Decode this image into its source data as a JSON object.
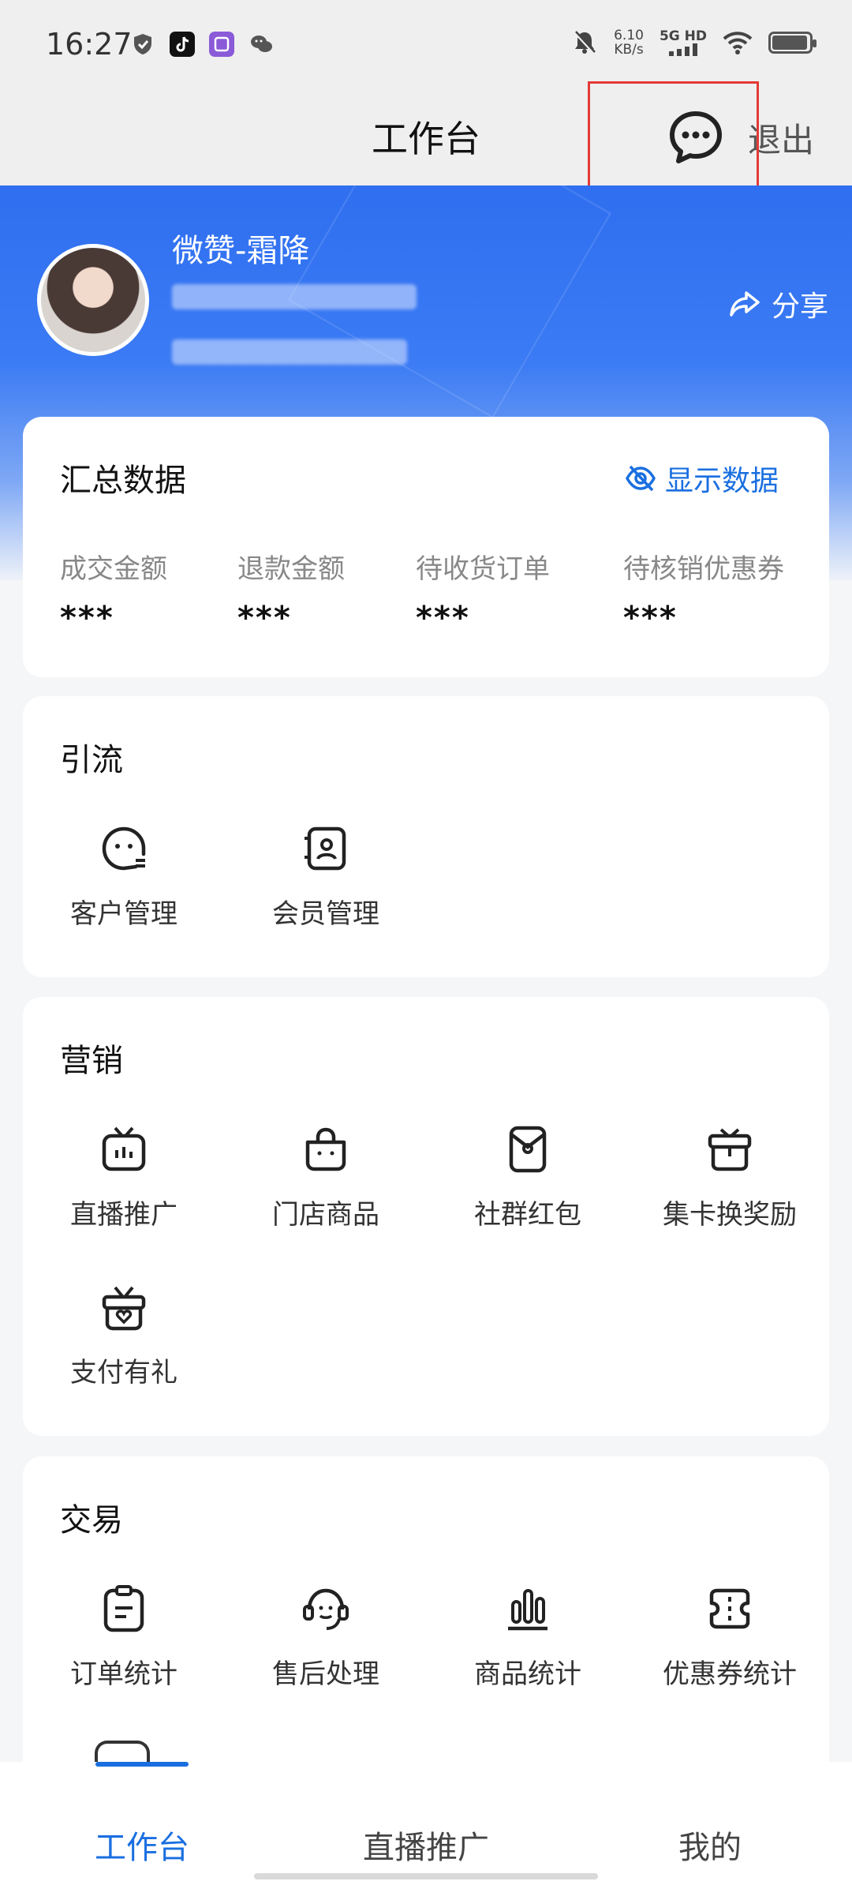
{
  "status_bar": {
    "time": "16:27",
    "net_speed_value": "6.10",
    "net_speed_unit": "KB/s",
    "signal_label": "5G HD"
  },
  "header": {
    "title": "工作台",
    "logout_label": "退出"
  },
  "profile": {
    "name": "微赞-霜降",
    "share_label": "分享"
  },
  "summary": {
    "title": "汇总数据",
    "show_data_label": "显示数据",
    "stats": [
      {
        "label": "成交金额",
        "value": "***"
      },
      {
        "label": "退款金额",
        "value": "***"
      },
      {
        "label": "待收货订单",
        "value": "***"
      },
      {
        "label": "待核销优惠券",
        "value": "***"
      }
    ]
  },
  "traffic": {
    "title": "引流",
    "items": [
      {
        "label": "客户管理",
        "icon": "customer-face-icon"
      },
      {
        "label": "会员管理",
        "icon": "member-card-icon"
      }
    ]
  },
  "marketing": {
    "title": "营销",
    "items": [
      {
        "label": "直播推广",
        "icon": "tv-icon"
      },
      {
        "label": "门店商品",
        "icon": "shopping-bag-icon"
      },
      {
        "label": "社群红包",
        "icon": "red-packet-icon"
      },
      {
        "label": "集卡换奖励",
        "icon": "gift-box-icon"
      },
      {
        "label": "支付有礼",
        "icon": "gift-heart-icon"
      }
    ]
  },
  "trade": {
    "title": "交易",
    "items": [
      {
        "label": "订单统计",
        "icon": "clipboard-icon"
      },
      {
        "label": "售后处理",
        "icon": "headset-icon"
      },
      {
        "label": "商品统计",
        "icon": "bar-chart-icon"
      },
      {
        "label": "优惠券统计",
        "icon": "ticket-icon"
      }
    ]
  },
  "tabbar": {
    "tabs": [
      {
        "label": "工作台"
      },
      {
        "label": "直播推广"
      },
      {
        "label": "我的"
      }
    ]
  },
  "colors": {
    "accent": "#1a6fe0",
    "banner": "#2f6ff0",
    "highlight": "#e53935"
  }
}
